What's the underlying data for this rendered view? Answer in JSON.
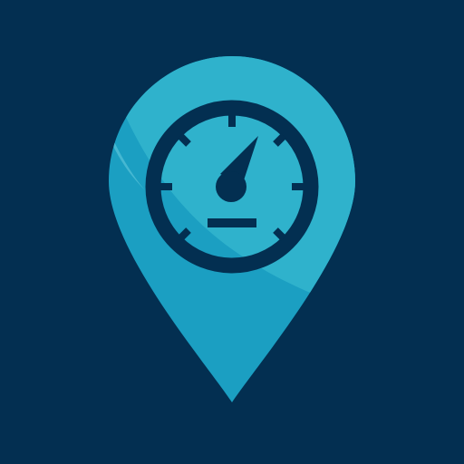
{
  "icon": {
    "name": "map-pin-speedometer-icon",
    "description_hidden": false
  },
  "colors": {
    "background": "#032f51",
    "pin_main": "#1b9fc2",
    "pin_highlight": "#2fb2cc",
    "pin_shadow": "#0b91b6",
    "gauge": "#032f51"
  },
  "gauge": {
    "needle_direction": "upper-right",
    "tick_marks": 7
  }
}
